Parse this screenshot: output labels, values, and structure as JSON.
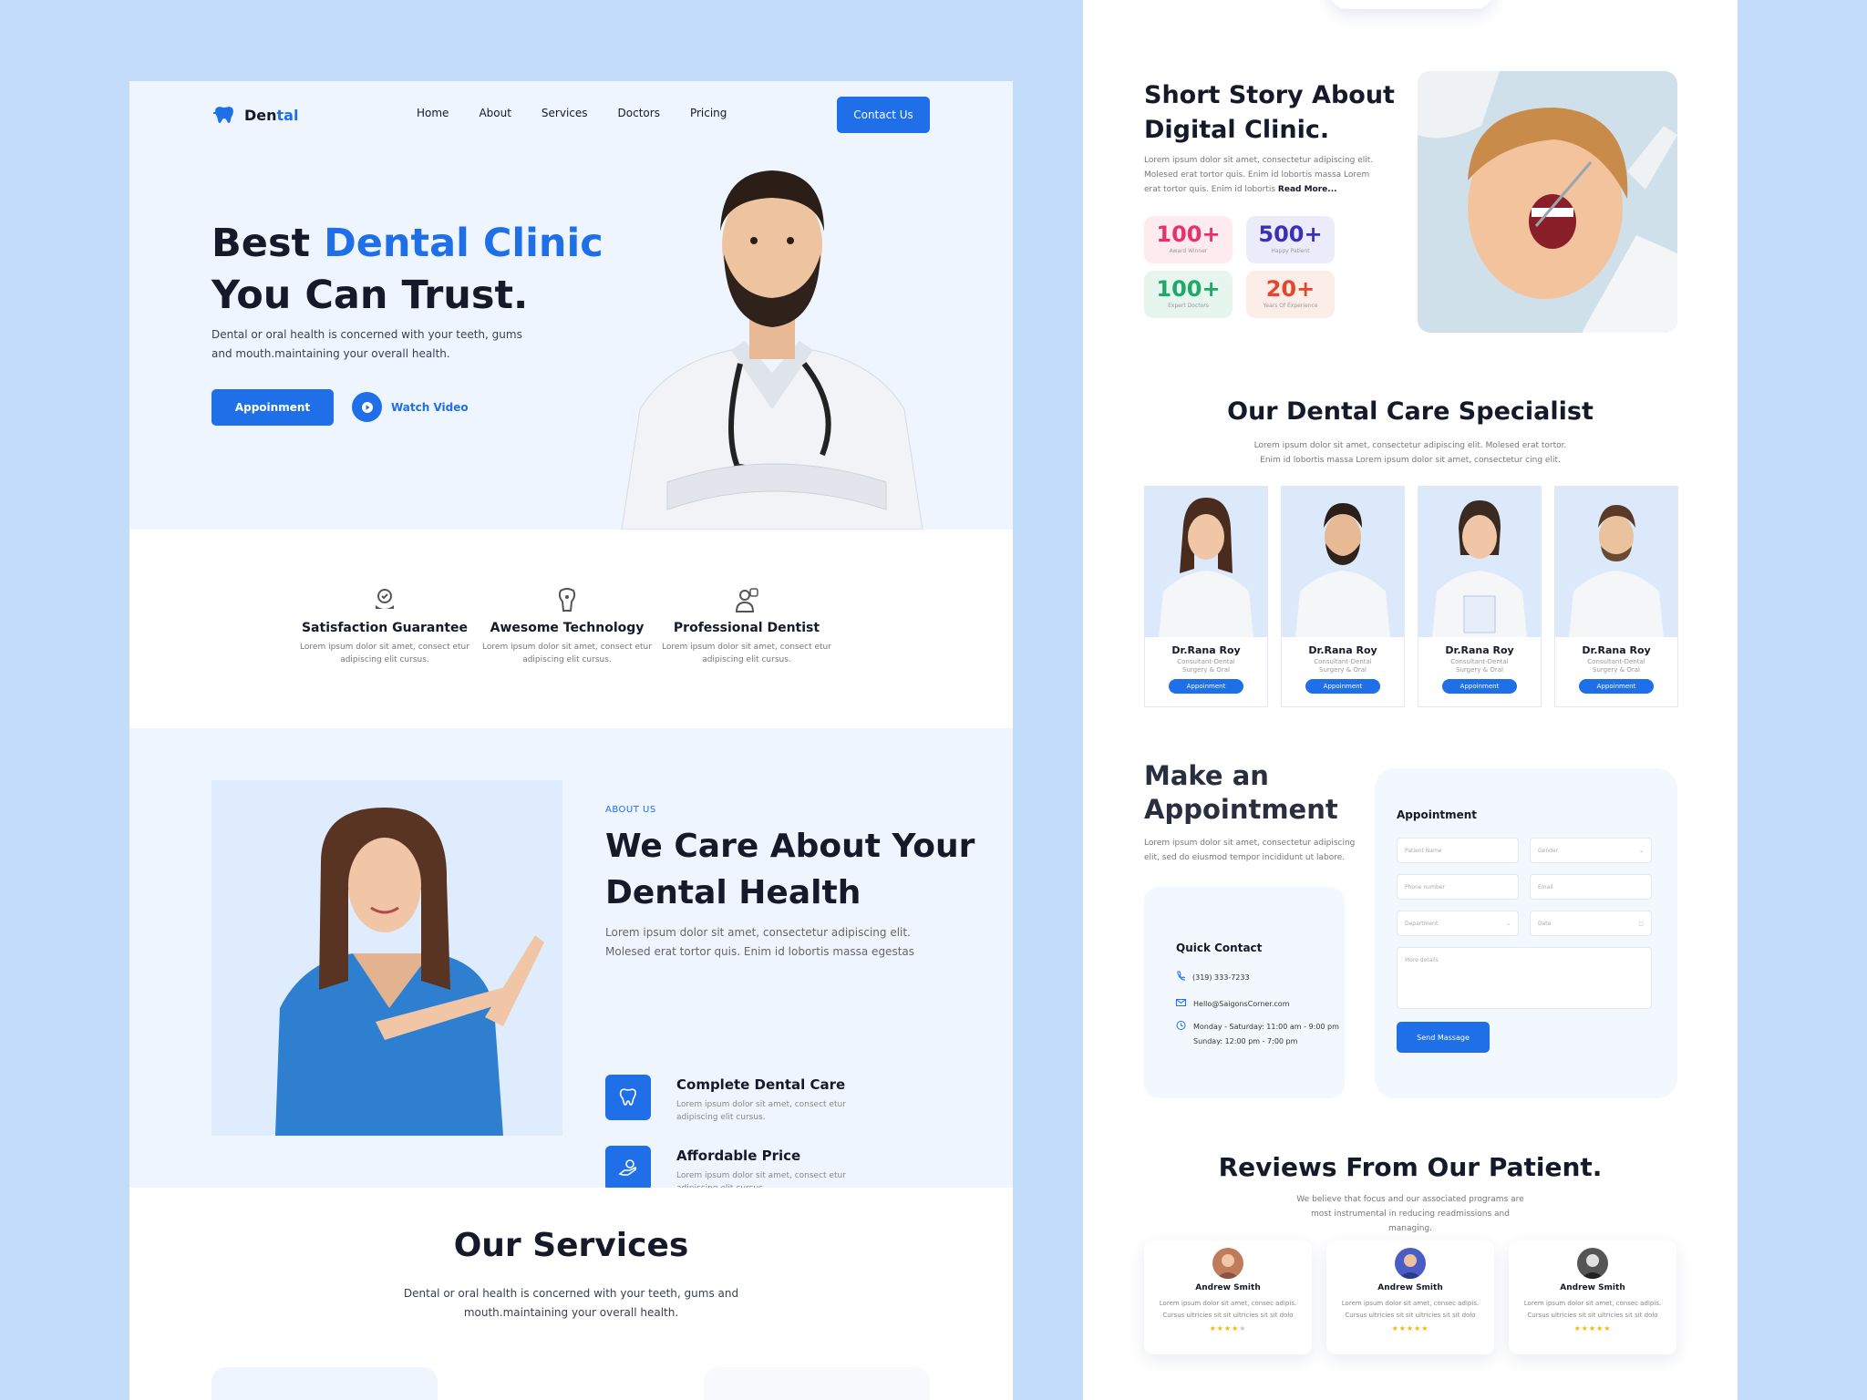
{
  "brand": {
    "name_part1": "Den",
    "name_part2": "tal",
    "logo_icon": "tooth-icon"
  },
  "nav": {
    "items": [
      "Home",
      "About",
      "Services",
      "Doctors",
      "Pricing"
    ],
    "contact_label": "Contact Us"
  },
  "hero": {
    "title_part1": "Best ",
    "title_highlight": "Dental Clinic",
    "title_part2": "You Can Trust.",
    "description": "Dental or oral health is concerned with your teeth, gums and mouth.maintaining your overall health.",
    "appointment_label": "Appoinment",
    "watch_label": "Watch Video"
  },
  "features": [
    {
      "icon": "satisfaction-icon",
      "title": "Satisfaction Guarantee",
      "text": "Lorem ipsum dolor sit amet, consect etur adipiscing elit cursus."
    },
    {
      "icon": "technology-icon",
      "title": "Awesome Technology",
      "text": "Lorem ipsum dolor sit amet, consect etur adipiscing elit cursus."
    },
    {
      "icon": "dentist-icon",
      "title": "Professional Dentist",
      "text": "Lorem ipsum dolor sit amet, consect etur adipiscing elit cursus."
    }
  ],
  "about": {
    "tag": "ABOUT US",
    "title": "We Care About Your Dental Health",
    "description": "Lorem ipsum dolor sit amet, consectetur adipiscing elit. Molesed erat tortor quis. Enim id lobortis massa egestas",
    "items": [
      {
        "icon": "tooth-icon",
        "title": "Complete Dental Care",
        "text": "Lorem ipsum dolor sit amet, consect etur adipiscing elit cursus."
      },
      {
        "icon": "price-icon",
        "title": "Affordable Price",
        "text": "Lorem ipsum dolor sit amet, consect etur adipiscing elit cursus."
      }
    ]
  },
  "services": {
    "title": "Our Services",
    "description": "Dental or oral health is concerned with your teeth, gums and mouth.maintaining your overall health."
  },
  "story": {
    "title": "Short Story About Digital Clinic.",
    "description": "Lorem ipsum dolor sit amet, consectetur adipiscing elit. Molesed erat tortor quis. Enim id lobortis massa Lorem erat tortor quis. Enim id lobortis",
    "read_more": "Read More...",
    "stats": [
      {
        "value": "100+",
        "label": "Award Winner",
        "color": "#e8316a",
        "bg": "#fdebf0"
      },
      {
        "value": "500+",
        "label": "Happy Patient",
        "color": "#3b2fb8",
        "bg": "#ecebfb"
      },
      {
        "value": "100+",
        "label": "Expert Doctors",
        "color": "#1ea86a",
        "bg": "#e6f6ee"
      },
      {
        "value": "20+",
        "label": "Years Of Experience",
        "color": "#e2492c",
        "bg": "#fdede8"
      }
    ]
  },
  "specialists": {
    "title": "Our Dental Care Specialist",
    "description": "Lorem ipsum dolor sit amet, consectetur adipiscing elit. Molesed erat tortor. Enim id lobortis massa Lorem ipsum dolor sit amet, consectetur cing elit.",
    "doctors": [
      {
        "name": "Dr.Rana Roy",
        "role1": "Consultant-Dental",
        "role2": "Surgery & Oral",
        "button": "Appoinment"
      },
      {
        "name": "Dr.Rana Roy",
        "role1": "Consultant-Dental",
        "role2": "Surgery & Oral",
        "button": "Appoinment"
      },
      {
        "name": "Dr.Rana Roy",
        "role1": "Consultant-Dental",
        "role2": "Surgery & Oral",
        "button": "Appoinment"
      },
      {
        "name": "Dr.Rana Roy",
        "role1": "Consultant-Dental",
        "role2": "Surgery & Oral",
        "button": "Appoinment"
      }
    ]
  },
  "appointment": {
    "title": "Make an Appointment",
    "description": "Lorem ipsum dolor sit amet, consectetur adipiscing elit, sed do eiusmod tempor incididunt ut labore.",
    "quick_contact": {
      "title": "Quick Contact",
      "phone": "(319) 333-7233",
      "email": "Hello@SaigonsCorner.com",
      "hours1": "Monday - Saturday: 11:00 am - 9:00 pm",
      "hours2": "Sunday: 12:00 pm - 7:00 pm"
    },
    "form": {
      "title": "Appointment",
      "patient_name": "Patient Name",
      "gender": "Gender",
      "phone": "Phone number",
      "email": "Email",
      "department": "Department",
      "date": "Date",
      "details": "More details",
      "send": "Send Massage"
    }
  },
  "reviews": {
    "title": "Reviews From Our Patient.",
    "description": "We believe that focus and our associated programs are most instrumental in reducing readmissions and managing.",
    "items": [
      {
        "name": "Andrew Smith",
        "text": "Lorem ipsum dolor sit amet, consec adipis. Cursus ultricies sit sit ultricies sit sit dolo",
        "stars": "★★★★★",
        "rating": 4
      },
      {
        "name": "Andrew Smith",
        "text": "Lorem ipsum dolor sit amet, consec adipis. Cursus ultricies sit sit ultricies sit sit dolo",
        "stars": "★★★★★",
        "rating": 5
      },
      {
        "name": "Andrew Smith",
        "text": "Lorem ipsum dolor sit amet, consec adipis. Cursus ultricies sit sit ultricies sit sit dolo",
        "stars": "★★★★★",
        "rating": 5
      }
    ]
  },
  "colors": {
    "accent": "#1e6fe8",
    "page_bg": "#c2dcfa",
    "hero_bg": "#eef5ff"
  }
}
